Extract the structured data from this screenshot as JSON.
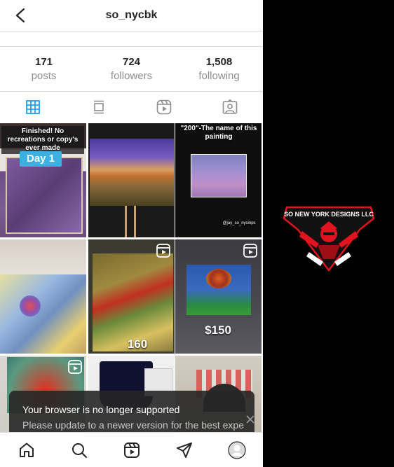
{
  "header": {
    "title": "so_nycbk"
  },
  "stats": [
    {
      "value": "171",
      "label": "posts"
    },
    {
      "value": "724",
      "label": "followers"
    },
    {
      "value": "1,508",
      "label": "following"
    }
  ],
  "grid": {
    "post1": {
      "caption_top": "Finished! No recreations or copy's ever made",
      "caption_badge": "Day 1"
    },
    "post3": {
      "caption": "\"200\"-The name of this painting",
      "watermark": "@jay_so_nysinps"
    },
    "post5": {
      "caption": "160"
    },
    "post6": {
      "caption": "$150"
    }
  },
  "toast": {
    "title": "Your browser is no longer supported",
    "message": "Please update to a newer version for the best expe"
  },
  "brand": {
    "logo_text": "SO NEW YORK DESIGNS LLC"
  },
  "colors": {
    "accent": "#0095f6",
    "brand_red": "#e0141e"
  }
}
